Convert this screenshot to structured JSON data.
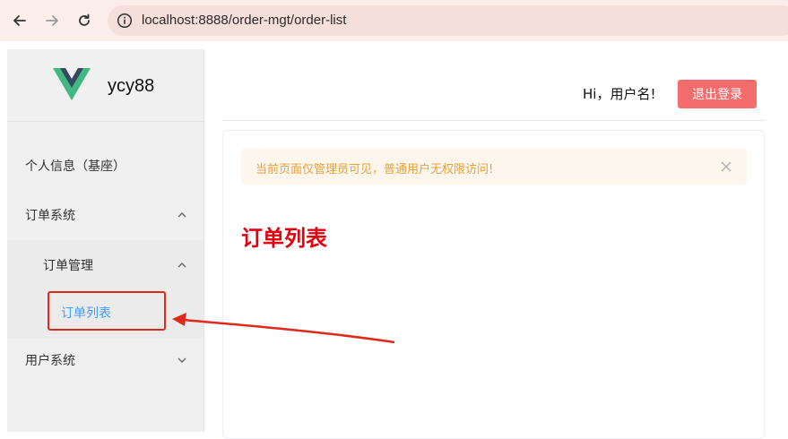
{
  "browser": {
    "url": "localhost:8888/order-mgt/order-list",
    "icons": [
      "back-icon",
      "forward-icon",
      "reload-icon",
      "info-icon"
    ]
  },
  "sidebar": {
    "brand": "ycy88",
    "items": [
      {
        "label": "个人信息（基座）"
      },
      {
        "label": "订单系统",
        "icon": "chevron-up-icon"
      },
      {
        "label": "订单管理",
        "icon": "chevron-up-icon"
      },
      {
        "label": "订单列表",
        "active": true
      },
      {
        "label": "用户系统",
        "icon": "chevron-down-icon"
      }
    ]
  },
  "header": {
    "greeting": "Hi，用户名!",
    "logout_label": "退出登录"
  },
  "main": {
    "alert_text": "当前页面仅管理员可见，普通用户无权限访问!",
    "title": "订单列表"
  },
  "colors": {
    "active": "#409eff",
    "danger": "#f56c6c",
    "warning_text": "#e6a23c",
    "heading": "#e3000f",
    "annotation": "#e0281b"
  }
}
